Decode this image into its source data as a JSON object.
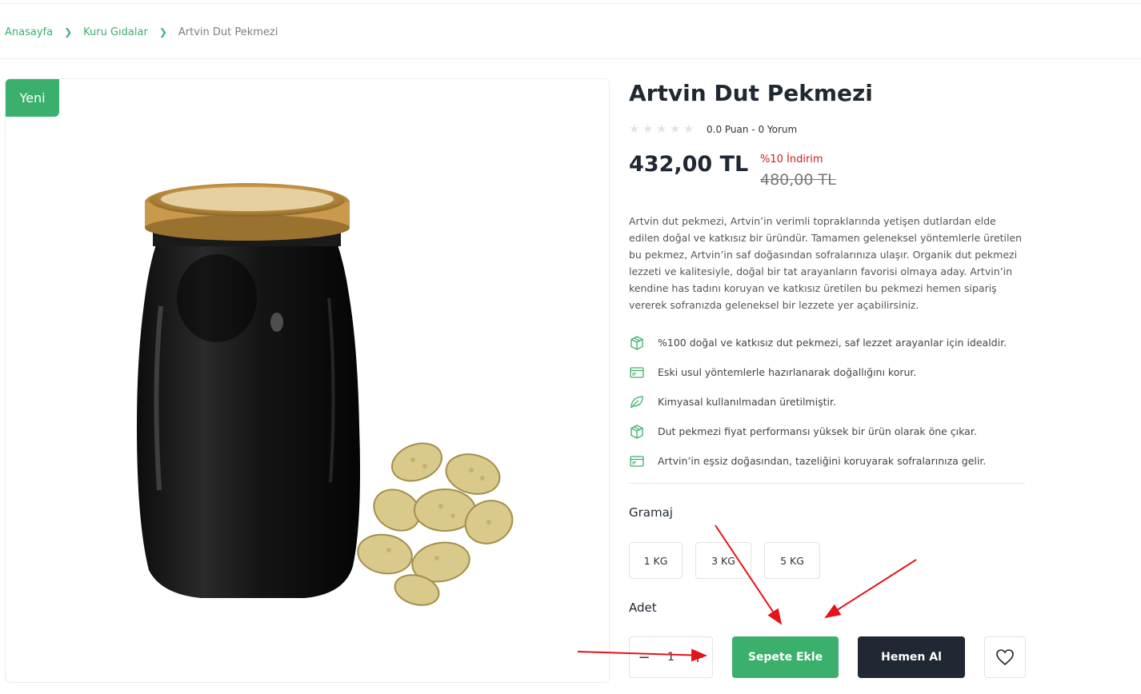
{
  "breadcrumb": {
    "items": [
      "Anasayfa",
      "Kuru Gıdalar"
    ],
    "current": "Artvin Dut Pekmezi"
  },
  "gallery": {
    "badge": "Yeni",
    "image_desc": "glass-jar-of-dark-mulberry-molasses-with-dried-white-mulberries"
  },
  "product": {
    "title": "Artvin Dut Pekmezi",
    "rating_value": 0.0,
    "rating_max": 5,
    "rating_text": "0.0 Puan - 0 Yorum",
    "price": "432,00 TL",
    "discount": "%10 İndirim",
    "old_price": "480,00 TL",
    "description": "Artvin dut pekmezi, Artvin’in verimli topraklarında yetişen dutlardan elde edilen doğal ve katkısız bir üründür. Tamamen geleneksel yöntemlerle üretilen bu pekmez, Artvin’in saf doğasından sofralarınıza ulaşır. Organik dut pekmezi lezzeti ve kalitesiyle, doğal bir tat arayanların favorisi olmaya aday. Artvin’in kendine has tadını koruyan ve katkısız üretilen bu pekmezi hemen sipariş vererek sofranızda geleneksel bir lezzete yer açabilirsiniz.",
    "features": [
      {
        "icon": "box-icon",
        "text": "%100 doğal ve katkısız dut pekmezi, saf lezzet arayanlar için idealdir."
      },
      {
        "icon": "card-icon",
        "text": "Eski usul yöntemlerle hazırlanarak doğallığını korur."
      },
      {
        "icon": "leaf-icon",
        "text": "Kimyasal kullanılmadan üretilmiştir."
      },
      {
        "icon": "box-icon",
        "text": "Dut pekmezi fiyat performansı yüksek bir ürün olarak öne çıkar."
      },
      {
        "icon": "card-icon",
        "text": "Artvin’in eşsiz doğasından, tazeliğini koruyarak sofralarınıza gelir."
      }
    ],
    "weight_label": "Gramaj",
    "weight_options": [
      "1 KG",
      "3 KG",
      "5 KG"
    ],
    "quantity_label": "Adet",
    "quantity": "1",
    "qty_minus": "−",
    "qty_plus": "+",
    "add_to_cart": "Sepete Ekle",
    "buy_now": "Hemen Al"
  },
  "colors": {
    "accent": "#3ab06c",
    "dark": "#1f2833",
    "discount": "#d11c1c",
    "annotation_arrow": "#e3121b"
  }
}
